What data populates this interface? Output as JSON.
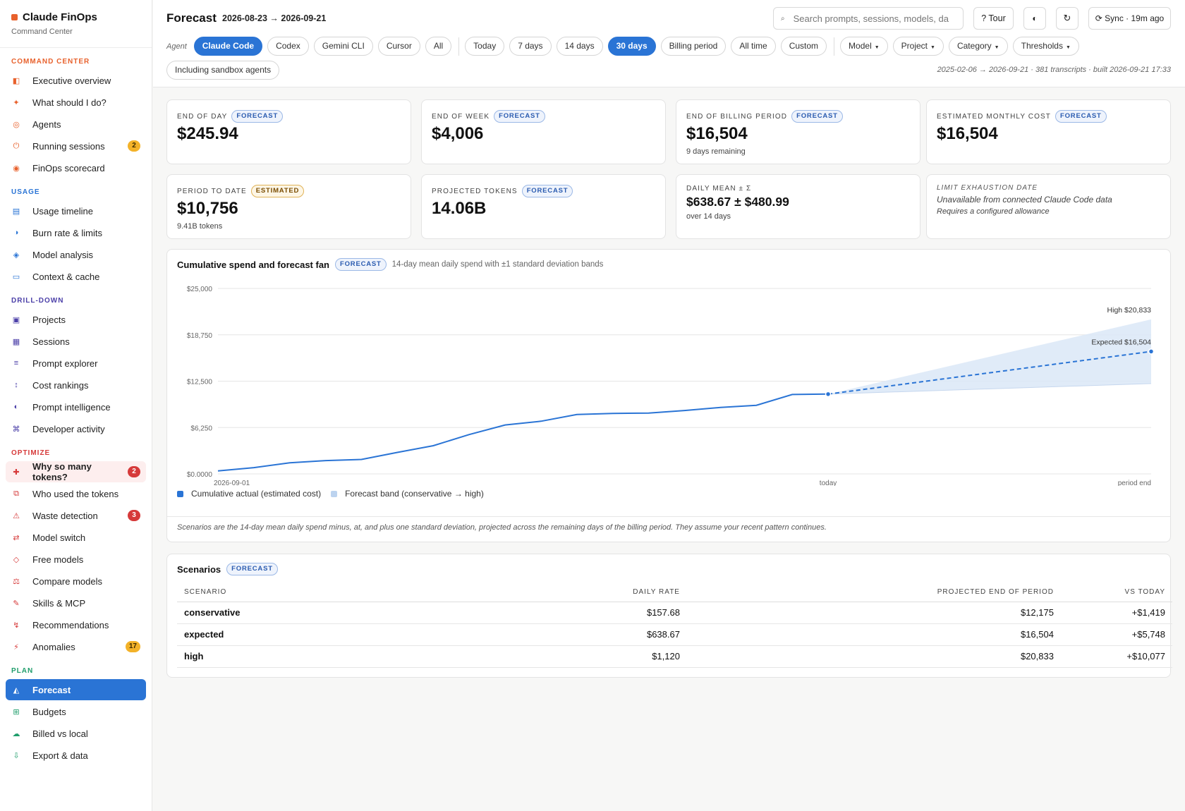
{
  "brand": {
    "name": "Claude FinOps",
    "subtitle": "Command Center"
  },
  "nav": [
    {
      "section": "COMMAND CENTER",
      "color": "#e8612c",
      "items": [
        {
          "label": "Executive overview",
          "icon": "overview-icon",
          "glyph": "◧",
          "color": "#e8612c"
        },
        {
          "label": "What should I do?",
          "icon": "sparkle-icon",
          "glyph": "✦",
          "color": "#e8612c"
        },
        {
          "label": "Agents",
          "icon": "agents-icon",
          "glyph": "◎",
          "color": "#e8612c"
        },
        {
          "label": "Running sessions",
          "icon": "power-icon",
          "glyph": "⏻",
          "color": "#e8612c",
          "badge": "2",
          "badge_color": "amber"
        },
        {
          "label": "FinOps scorecard",
          "icon": "scorecard-icon",
          "glyph": "◉",
          "color": "#e8612c"
        }
      ]
    },
    {
      "section": "USAGE",
      "color": "#2a74d5",
      "items": [
        {
          "label": "Usage timeline",
          "icon": "timeline-icon",
          "glyph": "▤",
          "color": "#2a74d5"
        },
        {
          "label": "Burn rate & limits",
          "icon": "burn-rate-icon",
          "glyph": "◑",
          "color": "#2a74d5"
        },
        {
          "label": "Model analysis",
          "icon": "model-analysis-icon",
          "glyph": "◈",
          "color": "#2a74d5"
        },
        {
          "label": "Context & cache",
          "icon": "context-icon",
          "glyph": "▭",
          "color": "#2a74d5"
        }
      ]
    },
    {
      "section": "DRILL-DOWN",
      "color": "#4b3fa8",
      "items": [
        {
          "label": "Projects",
          "icon": "projects-icon",
          "glyph": "▣",
          "color": "#4b3fa8"
        },
        {
          "label": "Sessions",
          "icon": "sessions-icon",
          "glyph": "▦",
          "color": "#4b3fa8"
        },
        {
          "label": "Prompt explorer",
          "icon": "prompt-explorer-icon",
          "glyph": "≡",
          "color": "#4b3fa8"
        },
        {
          "label": "Cost rankings",
          "icon": "rankings-icon",
          "glyph": "↕",
          "color": "#4b3fa8"
        },
        {
          "label": "Prompt intelligence",
          "icon": "intelligence-icon",
          "glyph": "◐",
          "color": "#4b3fa8"
        },
        {
          "label": "Developer activity",
          "icon": "developer-icon",
          "glyph": "⌘",
          "color": "#4b3fa8"
        }
      ]
    },
    {
      "section": "OPTIMIZE",
      "color": "#d63a3a",
      "items": [
        {
          "label": "Why so many tokens?",
          "icon": "alert-plus-icon",
          "glyph": "✚",
          "color": "#d63a3a",
          "badge": "2",
          "badge_color": "red",
          "alert": true
        },
        {
          "label": "Who used the tokens",
          "icon": "users-tokens-icon",
          "glyph": "⧉",
          "color": "#d63a3a"
        },
        {
          "label": "Waste detection",
          "icon": "warning-icon",
          "glyph": "⚠",
          "color": "#d63a3a",
          "badge": "3",
          "badge_color": "red"
        },
        {
          "label": "Model switch",
          "icon": "switch-icon",
          "glyph": "⇄",
          "color": "#d63a3a"
        },
        {
          "label": "Free models",
          "icon": "diamond-icon",
          "glyph": "◇",
          "color": "#d63a3a"
        },
        {
          "label": "Compare models",
          "icon": "compare-icon",
          "glyph": "⚖",
          "color": "#d63a3a"
        },
        {
          "label": "Skills & MCP",
          "icon": "skills-icon",
          "glyph": "✎",
          "color": "#d63a3a"
        },
        {
          "label": "Recommendations",
          "icon": "recommendations-icon",
          "glyph": "↯",
          "color": "#d63a3a"
        },
        {
          "label": "Anomalies",
          "icon": "bolt-icon",
          "glyph": "⚡",
          "color": "#d63a3a",
          "badge": "17",
          "badge_color": "amber"
        }
      ]
    },
    {
      "section": "PLAN",
      "color": "#1f9d6b",
      "items": [
        {
          "label": "Forecast",
          "icon": "forecast-icon",
          "glyph": "◭",
          "color": "#1f9d6b",
          "active": true
        },
        {
          "label": "Budgets",
          "icon": "budgets-icon",
          "glyph": "⊞",
          "color": "#1f9d6b"
        },
        {
          "label": "Billed vs local",
          "icon": "cloud-icon",
          "glyph": "☁",
          "color": "#1f9d6b"
        },
        {
          "label": "Export & data",
          "icon": "download-icon",
          "glyph": "⇩",
          "color": "#1f9d6b"
        }
      ]
    }
  ],
  "header": {
    "title": "Forecast",
    "range": "2026-08-23 → 2026-09-21",
    "search_placeholder": "Search prompts, sessions, models, dates",
    "tour_label": "? Tour",
    "theme_icon": "contrast-icon",
    "refresh_icon": "refresh-icon",
    "sync_label": "⟳ Sync · 19m ago",
    "agent_label": "Agent",
    "agents": [
      "Claude Code",
      "Codex",
      "Gemini CLI",
      "Cursor",
      "All"
    ],
    "agent_selected": "Claude Code",
    "periods": [
      "Today",
      "7 days",
      "14 days",
      "30 days",
      "Billing period",
      "All time",
      "Custom"
    ],
    "period_selected": "30 days",
    "dropdowns": [
      "Model",
      "Project",
      "Category",
      "Thresholds"
    ],
    "sandbox_label": "Including sandbox agents",
    "meta": "2025-02-06 → 2026-09-21 · 381 transcripts · built 2026-09-21 17:33"
  },
  "kpis": [
    {
      "label": "END OF DAY",
      "tag": "FORECAST",
      "value": "$245.94",
      "sub": ""
    },
    {
      "label": "END OF WEEK",
      "tag": "FORECAST",
      "value": "$4,006",
      "sub": ""
    },
    {
      "label": "END OF BILLING PERIOD",
      "tag": "FORECAST",
      "value": "$16,504",
      "sub": "9 days remaining"
    },
    {
      "label": "ESTIMATED MONTHLY COST",
      "tag": "FORECAST",
      "value": "$16,504",
      "sub": ""
    },
    {
      "label": "PERIOD TO DATE",
      "tag": "ESTIMATED",
      "value": "$10,756",
      "sub": "9.41B tokens"
    },
    {
      "label": "PROJECTED TOKENS",
      "tag": "FORECAST",
      "value": "14.06B",
      "sub": ""
    },
    {
      "label": "DAILY MEAN ± Σ",
      "tag": "",
      "value": "$638.67 ± $480.99",
      "sub": "over 14 days"
    }
  ],
  "limit_card": {
    "label": "LIMIT EXHAUSTION DATE",
    "line1": "Unavailable from connected Claude Code data",
    "line2": "Requires a configured allowance"
  },
  "chart": {
    "title": "Cumulative spend and forecast fan",
    "tag": "FORECAST",
    "subtitle": "14-day mean daily spend with ±1 standard deviation bands",
    "legend": [
      {
        "label": "Cumulative actual (estimated cost)",
        "color": "#2a74d5"
      },
      {
        "label": "Forecast band (conservative → high)",
        "color": "#bcd3ef"
      }
    ],
    "note": "Scenarios are the 14-day mean daily spend minus, at, and plus one standard deviation, projected across the remaining days of the billing period. They assume your recent pattern continues."
  },
  "chart_data": {
    "type": "line",
    "yticks": [
      "$25,000",
      "$18,750",
      "$12,500",
      "$6,250",
      "$0.0000"
    ],
    "ylim": [
      0,
      25000
    ],
    "xlim": [
      0,
      26
    ],
    "xticks": [
      {
        "x": 0,
        "label": "2026-09-01"
      },
      {
        "x": 17,
        "label": "today"
      },
      {
        "x": 26,
        "label": "period end"
      }
    ],
    "actual": {
      "x": [
        0,
        1,
        2,
        3,
        4,
        5,
        6,
        7,
        8,
        9,
        10,
        11,
        12,
        13,
        14,
        15,
        16,
        17
      ],
      "y": [
        400,
        850,
        1500,
        1800,
        1950,
        2900,
        3800,
        5300,
        6600,
        7100,
        8000,
        8150,
        8200,
        8550,
        8950,
        9250,
        10700,
        10756
      ]
    },
    "forecast": {
      "x": [
        17,
        26
      ],
      "expected": [
        10756,
        16504
      ],
      "conservative": [
        10756,
        12175
      ],
      "high": [
        10756,
        20833
      ]
    },
    "annotations": [
      {
        "label": "High $20,833",
        "series": "high"
      },
      {
        "label": "Expected $16,504",
        "series": "expected"
      }
    ],
    "grid": true
  },
  "scenarios": {
    "title": "Scenarios",
    "tag": "FORECAST",
    "columns": [
      "SCENARIO",
      "DAILY RATE",
      "PROJECTED END OF PERIOD",
      "VS TODAY"
    ],
    "rows": [
      [
        "conservative",
        "$157.68",
        "$12,175",
        "+$1,419"
      ],
      [
        "expected",
        "$638.67",
        "$16,504",
        "+$5,748"
      ],
      [
        "high",
        "$1,120",
        "$20,833",
        "+$10,077"
      ]
    ]
  }
}
